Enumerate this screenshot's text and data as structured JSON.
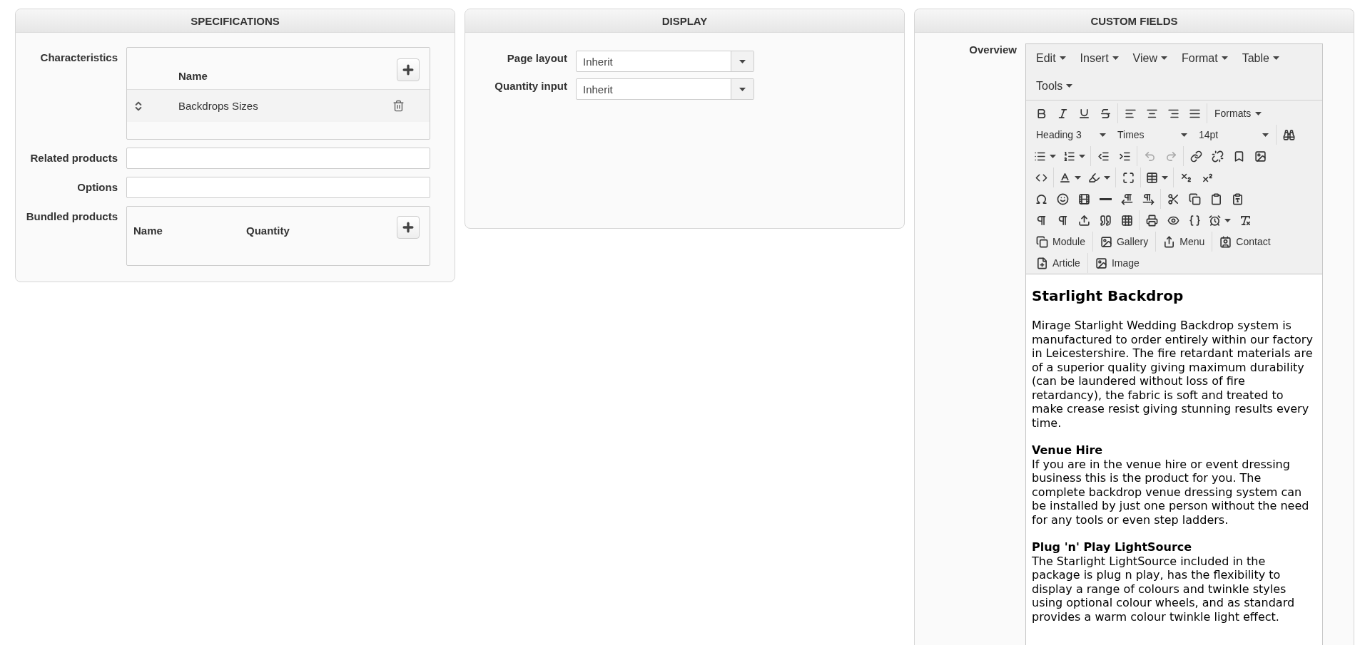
{
  "specifications": {
    "title": "SPECIFICATIONS",
    "characteristics": {
      "label": "Characteristics",
      "column": "Name",
      "rows": [
        {
          "name": "Backdrops Sizes"
        }
      ]
    },
    "related_products": {
      "label": "Related products"
    },
    "options": {
      "label": "Options"
    },
    "bundled_products": {
      "label": "Bundled products",
      "columns": [
        "Name",
        "Quantity"
      ]
    }
  },
  "display": {
    "title": "DISPLAY",
    "fields": [
      {
        "label": "Page layout",
        "value": "Inherit"
      },
      {
        "label": "Quantity input",
        "value": "Inherit"
      }
    ]
  },
  "custom_fields": {
    "title": "CUSTOM FIELDS",
    "label": "Overview",
    "menus": [
      [
        "Edit",
        "Insert",
        "View",
        "Format",
        "Table"
      ],
      [
        "Tools"
      ]
    ],
    "toolbar_rows": [
      [
        [
          {
            "kind": "icon",
            "disabled": false
          },
          {
            "kind": "icon",
            "disabled": false
          },
          {
            "kind": "icon",
            "disabled": false
          },
          {
            "kind": "icon",
            "disabled": false
          }
        ],
        [
          {
            "kind": "icon",
            "disabled": false
          },
          {
            "kind": "icon",
            "disabled": false
          },
          {
            "kind": "icon",
            "disabled": false
          },
          {
            "kind": "icon",
            "disabled": false
          }
        ],
        [
          {
            "kind": "menu",
            "label": "Formats"
          }
        ]
      ],
      [
        [
          {
            "kind": "select",
            "label": "Heading 3"
          },
          {
            "kind": "select",
            "label": "Times"
          },
          {
            "kind": "select",
            "label": "14pt"
          }
        ],
        [
          {
            "kind": "icon",
            "disabled": false
          }
        ]
      ],
      [
        [
          {
            "kind": "split",
            "disabled": false
          },
          {
            "kind": "split",
            "disabled": false
          }
        ],
        [
          {
            "kind": "icon",
            "disabled": false
          },
          {
            "kind": "icon",
            "disabled": false
          }
        ],
        [
          {
            "kind": "icon",
            "disabled": true
          },
          {
            "kind": "icon",
            "disabled": true
          }
        ],
        [
          {
            "kind": "icon",
            "disabled": false
          },
          {
            "kind": "icon",
            "disabled": false
          },
          {
            "kind": "icon",
            "disabled": false
          },
          {
            "kind": "icon",
            "disabled": false
          }
        ]
      ],
      [
        [
          {
            "kind": "icon",
            "disabled": false
          }
        ],
        [
          {
            "kind": "split",
            "disabled": false
          },
          {
            "kind": "split",
            "disabled": false
          }
        ],
        [
          {
            "kind": "icon",
            "disabled": false
          }
        ],
        [
          {
            "kind": "split",
            "disabled": false
          }
        ],
        [
          {
            "kind": "icon",
            "disabled": false
          },
          {
            "kind": "icon",
            "disabled": false
          }
        ]
      ],
      [
        [
          {
            "kind": "icon",
            "disabled": false
          },
          {
            "kind": "icon",
            "disabled": false
          },
          {
            "kind": "icon",
            "disabled": false
          },
          {
            "kind": "icon",
            "disabled": false
          },
          {
            "kind": "icon",
            "disabled": false
          },
          {
            "kind": "icon",
            "disabled": false
          }
        ],
        [
          {
            "kind": "icon",
            "disabled": false
          },
          {
            "kind": "icon",
            "disabled": false
          },
          {
            "kind": "icon",
            "disabled": false
          },
          {
            "kind": "icon",
            "disabled": false
          }
        ]
      ],
      [
        [
          {
            "kind": "icon",
            "disabled": false
          },
          {
            "kind": "icon",
            "disabled": false
          },
          {
            "kind": "icon",
            "disabled": false
          },
          {
            "kind": "icon",
            "disabled": false
          },
          {
            "kind": "icon",
            "disabled": false
          }
        ],
        [
          {
            "kind": "icon",
            "disabled": false
          },
          {
            "kind": "icon",
            "disabled": false
          },
          {
            "kind": "icon",
            "disabled": false
          },
          {
            "kind": "split",
            "disabled": false
          },
          {
            "kind": "icon",
            "disabled": false
          }
        ]
      ],
      [
        [
          {
            "kind": "button",
            "label": "Module"
          }
        ],
        [
          {
            "kind": "button",
            "label": "Gallery"
          }
        ],
        [
          {
            "kind": "button",
            "label": "Menu"
          }
        ],
        [
          {
            "kind": "button",
            "label": "Contact"
          }
        ]
      ],
      [
        [
          {
            "kind": "button",
            "label": "Article"
          }
        ],
        [
          {
            "kind": "button",
            "label": "Image"
          }
        ]
      ]
    ],
    "content": [
      {
        "kind": "heading",
        "text": "Starlight Backdrop"
      },
      {
        "kind": "paragraph",
        "text": "Mirage Starlight Wedding Backdrop system is manufactured to order entirely within our factory in Leicestershire. The fire retardant materials are of a superior quality giving maximum durability (can be laundered without loss of fire retardancy), the fabric is soft and treated to make crease resist giving stunning results every time."
      },
      {
        "kind": "section",
        "title": "Venue Hire",
        "text": "If you are in the venue hire or event dressing business this is the product for you. The complete backdrop venue dressing system can be installed by just one person without the need for any tools or even step ladders."
      },
      {
        "kind": "section",
        "title": "Plug 'n' Play LightSource",
        "text": "The Starlight LightSource included in the package is plug n play, has the flexibility to display a range of colours and twinkle styles using optional colour wheels, and as standard provides a warm colour twinkle light effect."
      }
    ]
  }
}
